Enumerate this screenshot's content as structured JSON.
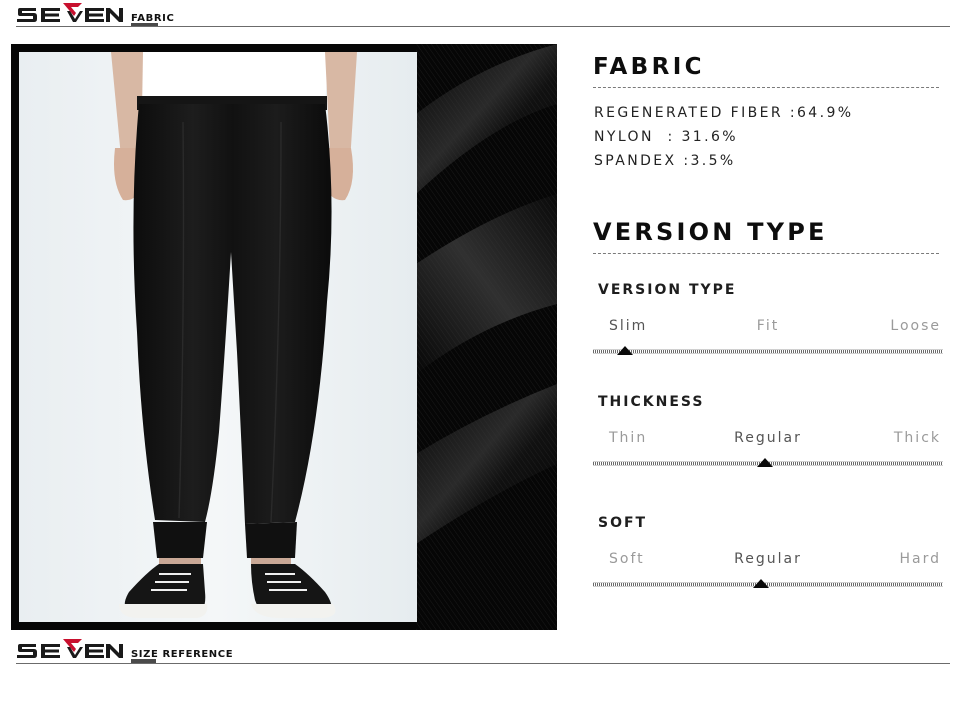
{
  "brand": {
    "logo_text": "SEVEN",
    "accent": "#c8102e",
    "ink": "#1a1a1a"
  },
  "header_top": {
    "label": "FABRIC"
  },
  "header_bottom": {
    "label": "SIZE REFERENCE"
  },
  "fabric": {
    "title": "FABRIC",
    "composition": [
      "REGENERATED FIBER :64.9%",
      "NYLON  : 31.6%",
      "SPANDEX :3.5%"
    ]
  },
  "version": {
    "title": "VERSION TYPE",
    "scales": [
      {
        "title": "VERSION TYPE",
        "options": [
          "Slim",
          "Fit",
          "Loose"
        ],
        "selected_index": 0,
        "marker_fraction": 0.09
      },
      {
        "title": "THICKNESS",
        "options": [
          "Thin",
          "Regular",
          "Thick"
        ],
        "selected_index": 1,
        "marker_fraction": 0.49
      },
      {
        "title": "SOFT",
        "options": [
          "Soft",
          "Regular",
          "Hard"
        ],
        "selected_index": 1,
        "marker_fraction": 0.48
      }
    ]
  },
  "colors": {
    "panel_bg": "#060606",
    "photo_bg": "#eef2f4",
    "pants": "#141414",
    "rule": "#6b6b6b"
  }
}
